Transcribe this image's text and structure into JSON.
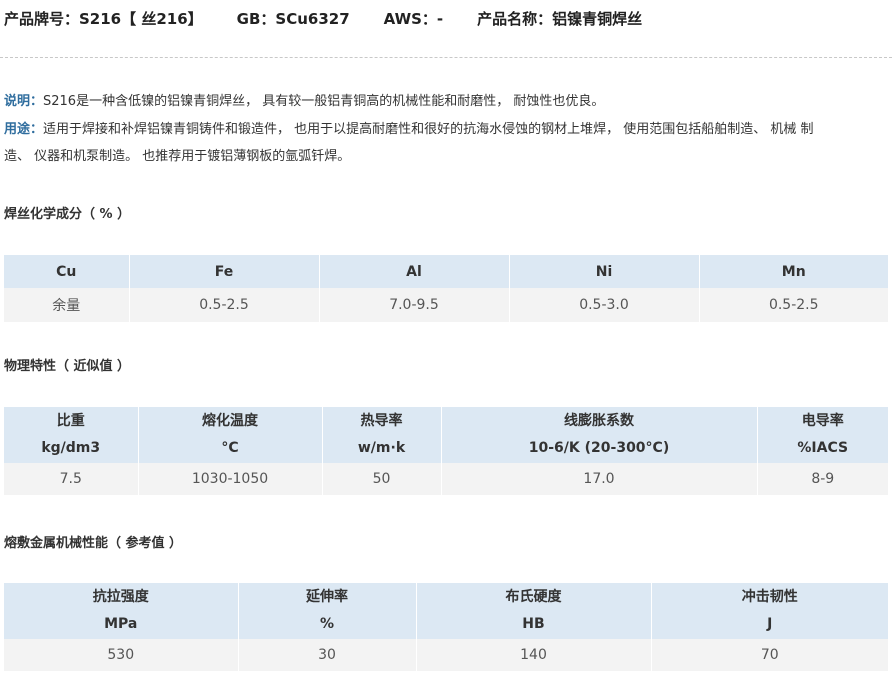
{
  "header": {
    "model": "产品牌号：S216【 丝216】",
    "gb": "GB：SCu6327",
    "aws": "AWS：-",
    "name": "产品名称：铝镍青铜焊丝"
  },
  "description": {
    "label": "说明：",
    "text": "S216是一种含低镍的铝镍青铜焊丝， 具有较一般铝青铜高的机械性能和耐磨性， 耐蚀性也优良。"
  },
  "usage": {
    "label": "用途：",
    "text_line1": "适用于焊接和补焊铝镍青铜铸件和锻造件， 也用于以提高耐磨性和很好的抗海水侵蚀的钢材上堆焊， 使用范围包括船舶制造、 机械 制",
    "text_line2": "造、 仪器和机泵制造。 也推荐用于镀铝薄钢板的氩弧钎焊。"
  },
  "composition": {
    "title": "焊丝化学成分（ % ）",
    "headers": [
      "Cu",
      "Fe",
      "Al",
      "Ni",
      "Mn"
    ],
    "values": [
      "余量",
      "0.5-2.5",
      "7.0-9.5",
      "0.5-3.0",
      "0.5-2.5"
    ]
  },
  "physical": {
    "title": "物理特性（ 近似值 ）",
    "headers": [
      {
        "name": "比重",
        "unit": "kg/dm3"
      },
      {
        "name": "熔化温度",
        "unit": "°C"
      },
      {
        "name": "热导率",
        "unit": "w/m·k"
      },
      {
        "name": "线膨胀系数",
        "unit": "10-6/K (20-300°C)"
      },
      {
        "name": "电导率",
        "unit": "%IACS"
      }
    ],
    "values": [
      "7.5",
      "1030-1050",
      "50",
      "17.0",
      "8-9"
    ]
  },
  "mechanical": {
    "title": "熔敷金属机械性能（ 参考值 ）",
    "headers": [
      {
        "name": "抗拉强度",
        "unit": "MPa"
      },
      {
        "name": "延伸率",
        "unit": "%"
      },
      {
        "name": "布氏硬度",
        "unit": "HB"
      },
      {
        "name": "冲击韧性",
        "unit": "J"
      }
    ],
    "values": [
      "530",
      "30",
      "140",
      "70"
    ]
  },
  "colors": {
    "label_blue": "#2f6d9e",
    "header_bg": "#dce8f3",
    "cell_bg": "#f3f3f3"
  }
}
